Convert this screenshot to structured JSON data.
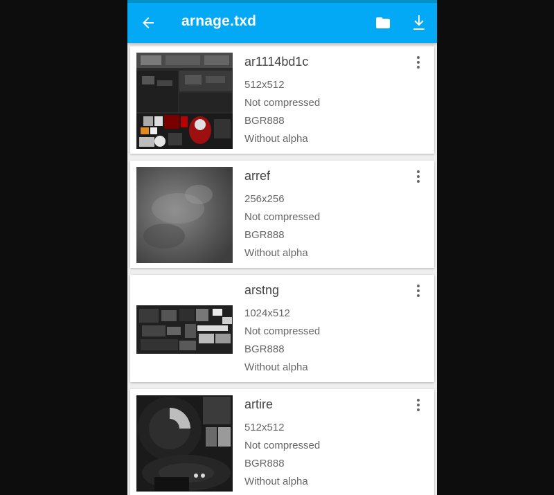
{
  "appbar": {
    "title": "arnage.txd",
    "back_icon": "arrow-left-icon",
    "folder_icon": "folder-icon",
    "download_icon": "download-icon",
    "color": "#03a9f4"
  },
  "textures": [
    {
      "name": "ar1114bd1c",
      "size": "512x512",
      "compression": "Not compressed",
      "format": "BGR888",
      "alpha": "Without alpha"
    },
    {
      "name": "arref",
      "size": "256x256",
      "compression": "Not compressed",
      "format": "BGR888",
      "alpha": "Without alpha"
    },
    {
      "name": "arstng",
      "size": "1024x512",
      "compression": "Not compressed",
      "format": "BGR888",
      "alpha": "Without alpha"
    },
    {
      "name": "artire",
      "size": "512x512",
      "compression": "Not compressed",
      "format": "BGR888",
      "alpha": "Without alpha"
    }
  ]
}
